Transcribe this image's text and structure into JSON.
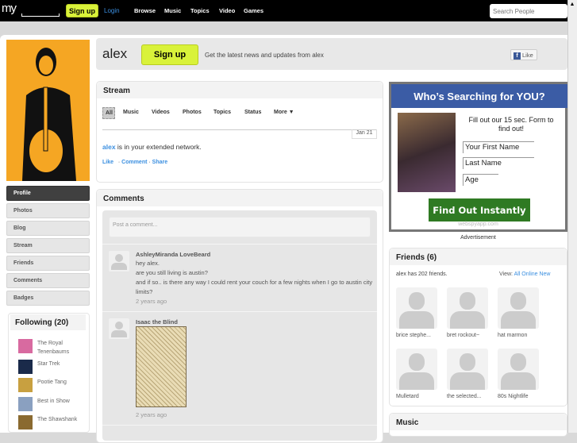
{
  "topbar": {
    "logo": "my",
    "signup": "Sign up",
    "login": "Login",
    "nav": [
      "Browse",
      "Music",
      "Topics",
      "Video",
      "Games"
    ],
    "search_placeholder": "Search People"
  },
  "profile": {
    "name": "alex",
    "signup": "Sign up",
    "tagline": "Get the latest news and updates from alex",
    "like": "Like"
  },
  "sidebar": {
    "items": [
      "Profile",
      "Photos",
      "Blog",
      "Stream",
      "Friends",
      "Comments",
      "Badges"
    ],
    "following_title": "Following (20)",
    "following": [
      "The Royal Tenenbaums",
      "Star Trek",
      "Pootie Tang",
      "Best in Show",
      "The Shawshank"
    ]
  },
  "stream": {
    "title": "Stream",
    "tabs": [
      "All",
      "Music",
      "Videos",
      "Photos",
      "Topics",
      "Status",
      "More ▼"
    ],
    "date": "Jan 21",
    "user": "alex",
    "text": " is in your extended network.",
    "actions": [
      "Like",
      "Comment",
      "Share"
    ]
  },
  "comments": {
    "title": "Comments",
    "placeholder": "Post a comment...",
    "items": [
      {
        "author": "AshleyMiranda LoveBeard",
        "lines": [
          "hey alex.",
          "are you still living is austin?",
          "and if so.. is there any way I could rent your couch for a few nights when I go to austin city limits?"
        ],
        "time": "2 years ago"
      },
      {
        "author": "Isaac the Blind",
        "time": "2 years ago"
      }
    ]
  },
  "ad": {
    "title": "Who’s Searching for YOU?",
    "text": "Fill out our 15 sec. Form to find out!",
    "fields": [
      "Your First Name",
      "Last Name",
      "Age"
    ],
    "button": "Find Out Instantly",
    "domain": "webspyapp.com",
    "label": "Advertisement"
  },
  "friends": {
    "title": "Friends (6)",
    "count_text": "alex has 202 friends.",
    "view_label": "View:",
    "view_options": [
      "All",
      "Online",
      "New"
    ],
    "names": [
      "brice stephe...",
      "bret rockout~",
      "hat marmon",
      "Mulletard",
      "the selected...",
      "80s Nightlife"
    ]
  },
  "music": {
    "title": "Music"
  }
}
